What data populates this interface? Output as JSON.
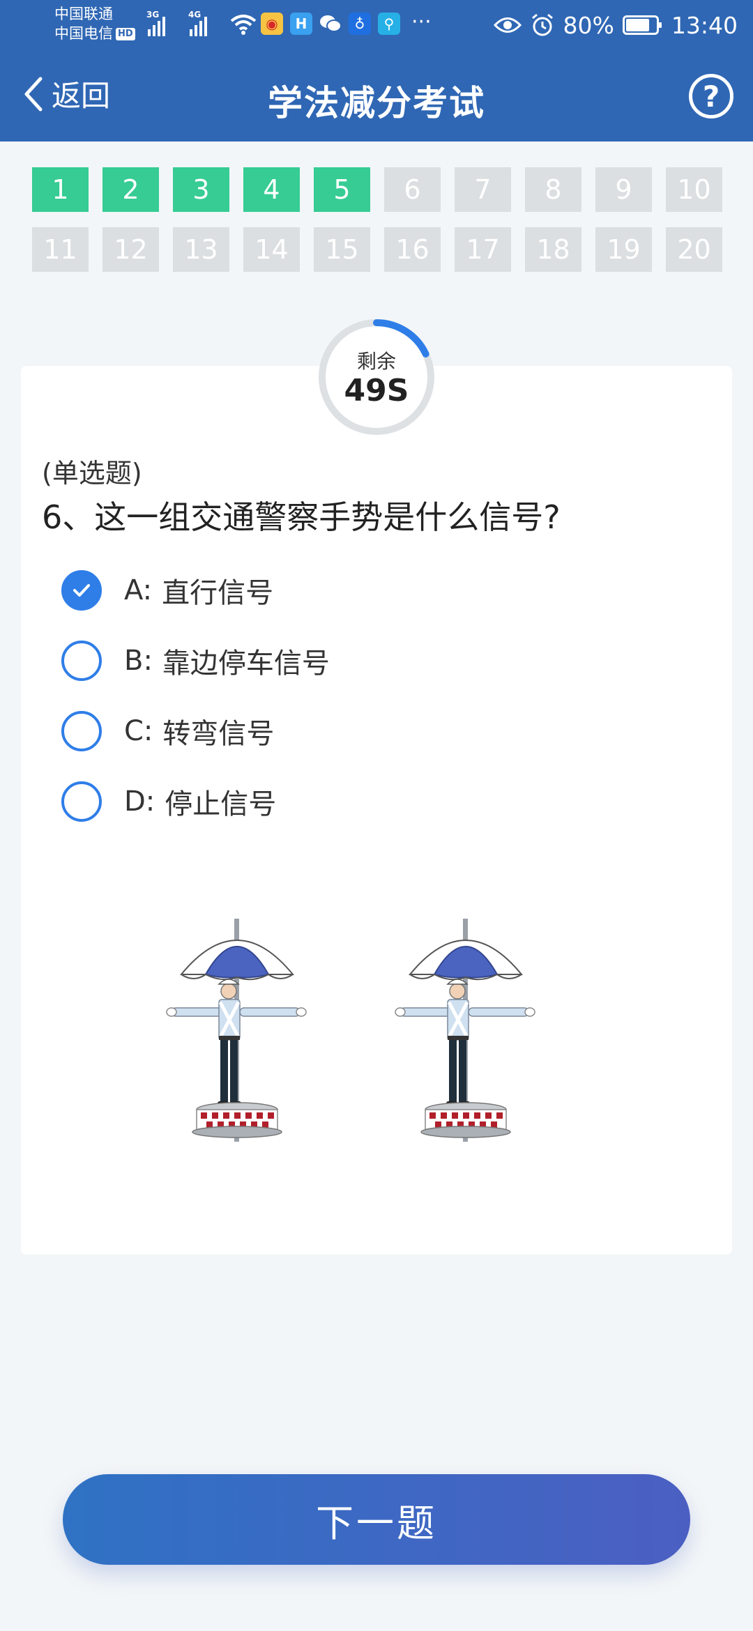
{
  "status_bar": {
    "carrier_1": "中国联通",
    "carrier_2": "中国电信",
    "hd_badge": "HD",
    "net_1": "3G",
    "net_2": "4G",
    "more": "···",
    "battery": "80%",
    "battery_level": 0.8,
    "time": "13:40",
    "icons": [
      "wifi-icon",
      "weibo-icon",
      "h-app-icon",
      "wechat-icon",
      "bulb-app-icon",
      "search-app-icon",
      "eye-icon",
      "alarm-icon",
      "battery-icon"
    ]
  },
  "header": {
    "back_label": "返回",
    "title": "学法减分考试",
    "help_glyph": "?"
  },
  "questions": {
    "numbers": [
      "1",
      "2",
      "3",
      "4",
      "5",
      "6",
      "7",
      "8",
      "9",
      "10",
      "11",
      "12",
      "13",
      "14",
      "15",
      "16",
      "17",
      "18",
      "19",
      "20"
    ],
    "answered_count": 5,
    "answered_color": "#36cc94",
    "unanswered_color": "#dcdfe1"
  },
  "timer": {
    "label": "剩余",
    "value": "49S",
    "remaining_fraction": 0.18,
    "accent": "#2f7ee8"
  },
  "question": {
    "type": "(单选题)",
    "text": "6、这一组交通警察手势是什么信号?",
    "options": [
      {
        "letter": "A:",
        "text": "直行信号",
        "selected": true
      },
      {
        "letter": "B:",
        "text": "靠边停车信号",
        "selected": false
      },
      {
        "letter": "C:",
        "text": "转弯信号",
        "selected": false
      },
      {
        "letter": "D:",
        "text": "停止信号",
        "selected": false
      }
    ]
  },
  "next_button": {
    "label": "下一题"
  },
  "colors": {
    "brand": "#2f67b4",
    "accent": "#2f7ee8"
  }
}
